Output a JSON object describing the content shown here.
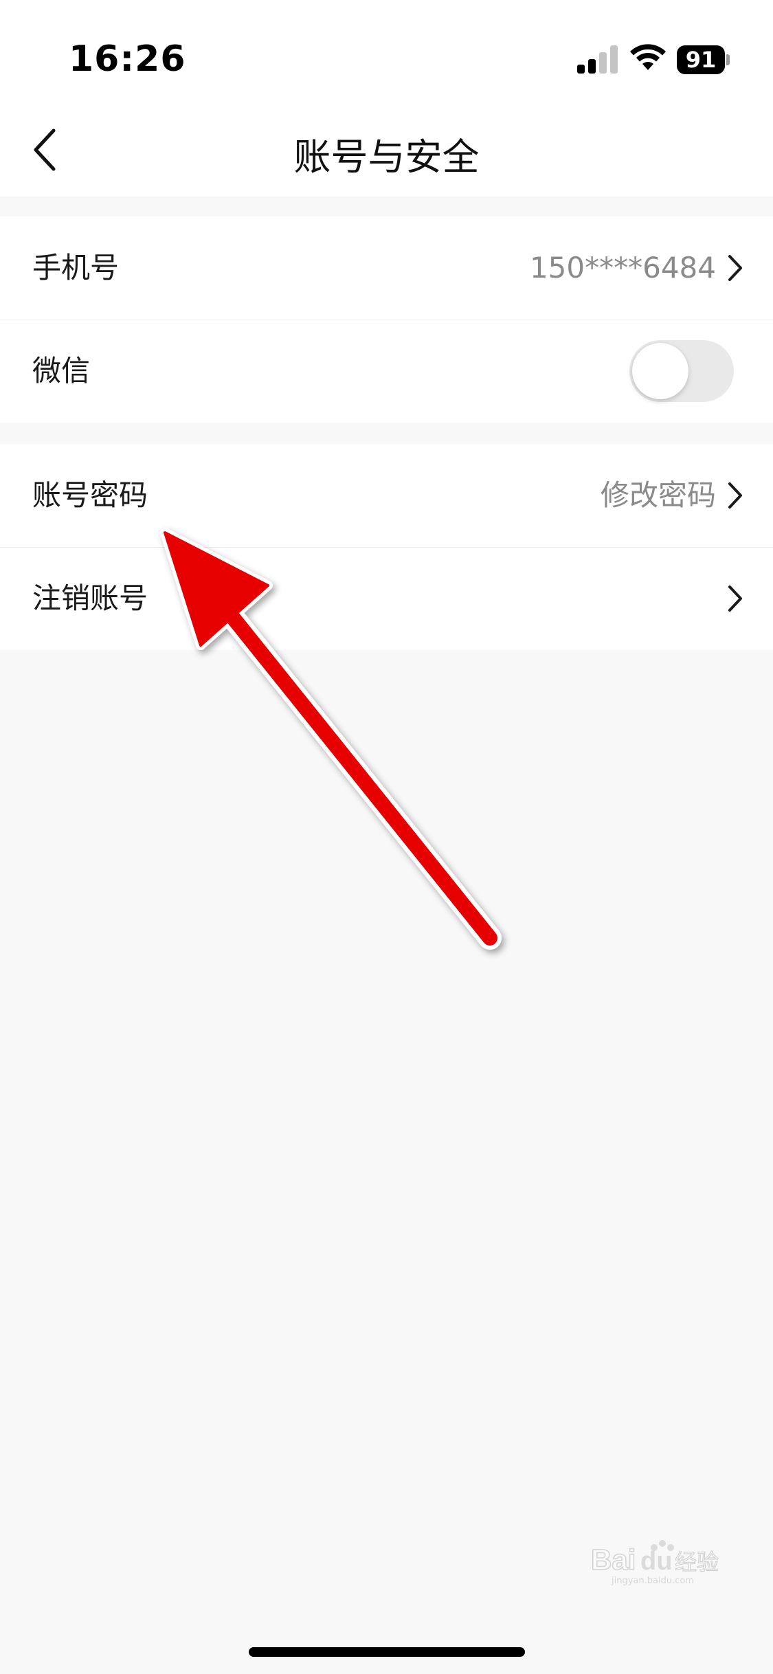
{
  "status_bar": {
    "time": "16:26",
    "battery_level": "91",
    "icons": [
      "signal-icon",
      "wifi-icon",
      "battery-icon"
    ]
  },
  "nav": {
    "title": "账号与安全",
    "back_icon": "chevron-left-icon"
  },
  "groups": [
    {
      "rows": [
        {
          "label": "手机号",
          "value": "150****6484",
          "accessory": "chevron-right-icon"
        },
        {
          "label": "微信",
          "toggle_on": false
        }
      ]
    },
    {
      "rows": [
        {
          "label": "账号密码",
          "value": "修改密码",
          "accessory": "chevron-right-icon"
        },
        {
          "label": "注销账号",
          "value": "",
          "accessory": "chevron-right-icon"
        }
      ]
    }
  ],
  "annotation": {
    "type": "arrow",
    "color": "#ff0000",
    "points_to": "账号密码"
  },
  "watermark": {
    "text": "Baidu经验",
    "subtext": "jingyan.baidu.com"
  },
  "colors": {
    "background": "#f8f8f8",
    "surface": "#ffffff",
    "secondary_text": "#8a8a8a",
    "toggle_off": "#e9e9ea"
  }
}
